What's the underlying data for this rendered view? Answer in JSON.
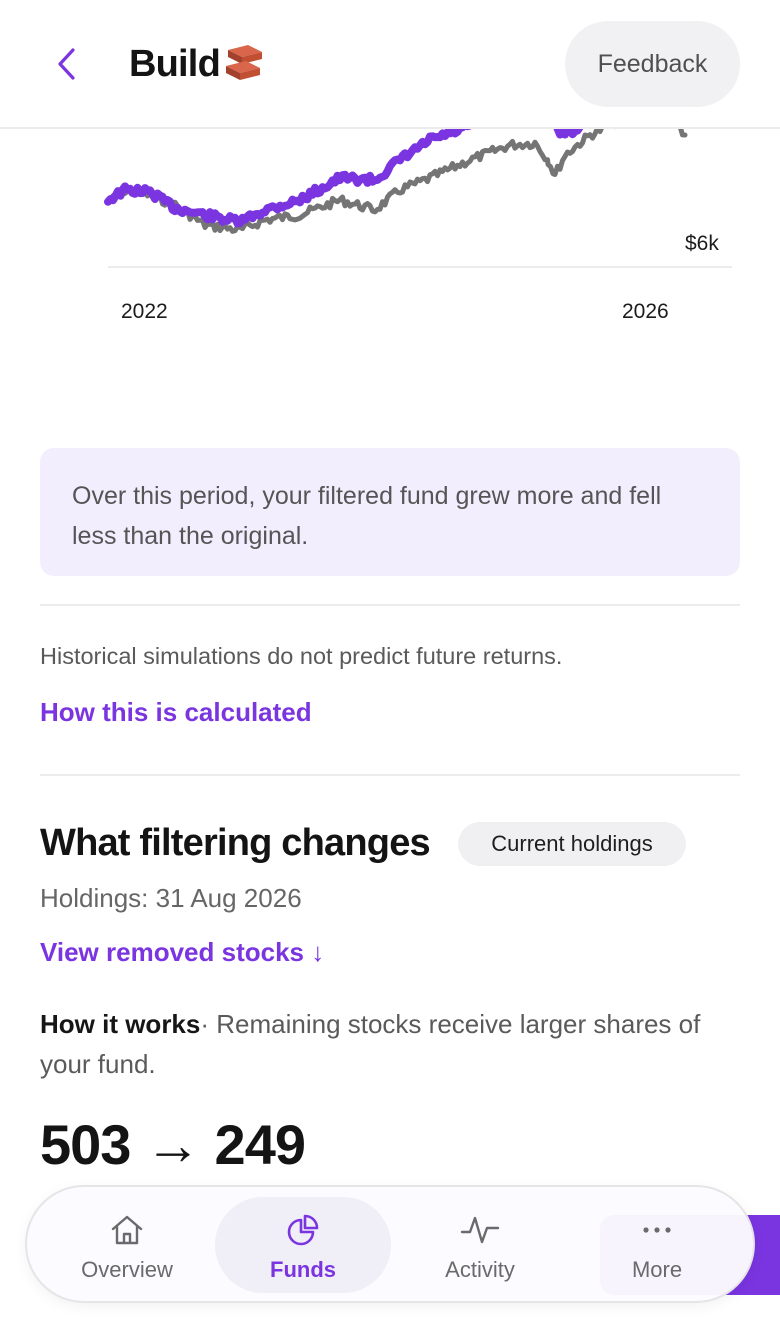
{
  "header": {
    "title": "Build",
    "feedback_label": "Feedback"
  },
  "chart_data": {
    "type": "line",
    "x_ticks": [
      "2022",
      "2026"
    ],
    "y_ticks": [
      "$6k"
    ],
    "series": [
      {
        "color": "#7a35e0"
      },
      {
        "color": "#757575"
      }
    ]
  },
  "callout": {
    "text": "Over this period, your filtered fund grew more and fell less than the original."
  },
  "disclaimer": "Historical simulations do not predict future returns.",
  "how_calculated_link": "How this is calculated",
  "filtering": {
    "title": "What filtering changes",
    "chip": "Current holdings",
    "holdings_date": "Holdings: 31 Aug 2026",
    "removed_link": "View removed stocks ↓",
    "how_works_label": "How it works",
    "how_works_text": "· Remaining stocks receive larger shares of your fund.",
    "count_change": "503 → 249"
  },
  "nav": {
    "items": [
      {
        "label": "Overview",
        "icon": "home-icon"
      },
      {
        "label": "Funds",
        "icon": "pie-chart-icon"
      },
      {
        "label": "Activity",
        "icon": "activity-icon"
      },
      {
        "label": "More",
        "icon": "more-icon"
      }
    ],
    "active": "Funds"
  },
  "colors": {
    "accent": "#7a35e0",
    "callout_bg": "#f2eefe"
  }
}
